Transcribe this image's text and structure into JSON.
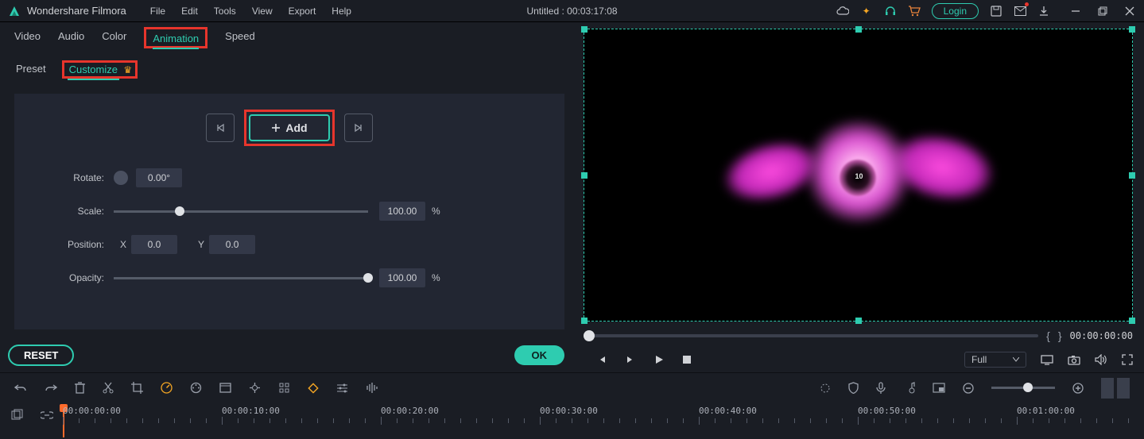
{
  "app_name": "Wondershare Filmora",
  "menubar": [
    "File",
    "Edit",
    "Tools",
    "View",
    "Export",
    "Help"
  ],
  "doc_title": "Untitled : 00:03:17:08",
  "login_label": "Login",
  "tabs": [
    "Video",
    "Audio",
    "Color",
    "Animation",
    "Speed"
  ],
  "active_tab_index": 3,
  "subtabs": [
    "Preset",
    "Customize"
  ],
  "active_subtab_index": 1,
  "add_label": "Add",
  "props": {
    "rotate_label": "Rotate:",
    "rotate_value": "0.00°",
    "scale_label": "Scale:",
    "scale_value": "100.00",
    "scale_pct": "%",
    "scale_slider_pct": 24,
    "position_label": "Position:",
    "pos_x_label": "X",
    "pos_x_value": "0.0",
    "pos_y_label": "Y",
    "pos_y_value": "0.0",
    "opacity_label": "Opacity:",
    "opacity_value": "100.00",
    "opacity_pct": "%",
    "opacity_slider_pct": 100
  },
  "reset_label": "RESET",
  "ok_label": "OK",
  "preview_badge": "10",
  "timecode_right": "00:00:00:00",
  "quality": "Full",
  "timeline_labels": [
    "00:00:00:00",
    "00:00:10:00",
    "00:00:20:00",
    "00:00:30:00",
    "00:00:40:00",
    "00:00:50:00",
    "00:01:00:00"
  ]
}
